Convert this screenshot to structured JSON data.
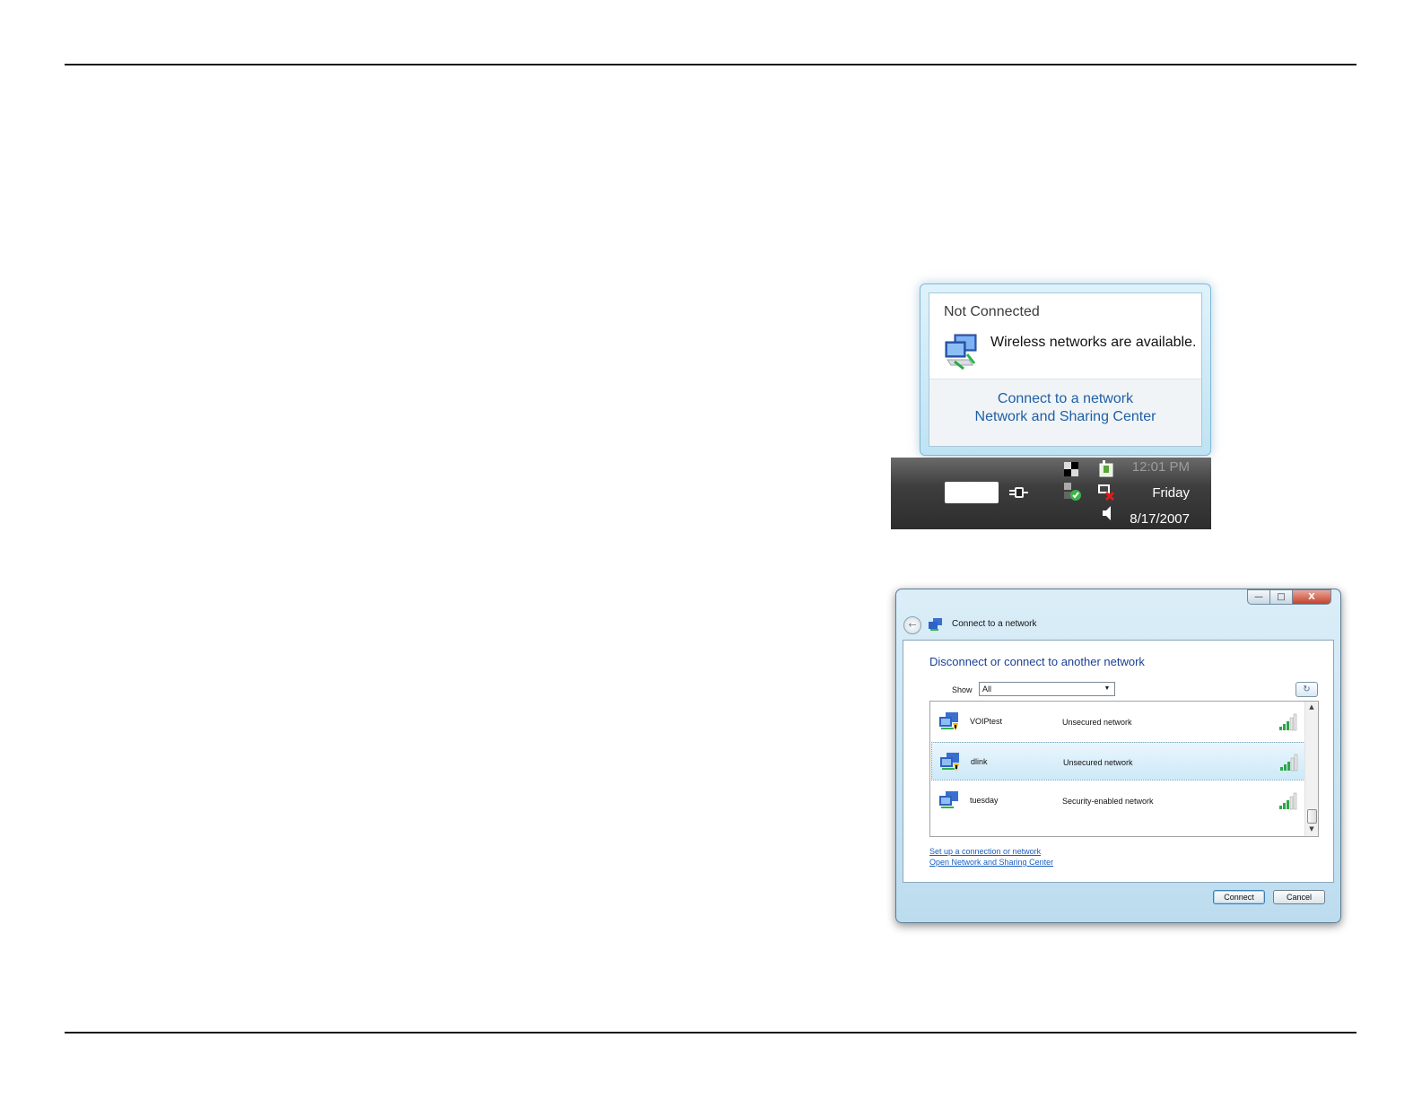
{
  "tray_popup": {
    "status_title": "Not Connected",
    "message": "Wireless networks are available.",
    "links": [
      "Connect to a network",
      "Network and Sharing Center"
    ],
    "icon": "network-computers-icon"
  },
  "taskbar": {
    "time": "12:01 PM",
    "day": "Friday",
    "date": "8/17/2007",
    "icons": [
      "power-plug-icon",
      "network-signal-icon",
      "security-shield-icon",
      "removable-device-icon",
      "network-disconnected-icon",
      "speaker-icon"
    ]
  },
  "connect_window": {
    "title": "Connect to a network",
    "controls": {
      "minimize": "—",
      "maximize": "□",
      "close": "X"
    },
    "heading": "Disconnect or connect to another network",
    "show_label": "Show",
    "show_value": "All",
    "networks": [
      {
        "name": "VOIPtest",
        "security": "Unsecured network",
        "signal": "excellent"
      },
      {
        "name": "dlink",
        "security": "Unsecured network",
        "signal": "excellent",
        "selected": true
      },
      {
        "name": "tuesday",
        "security": "Security-enabled network",
        "signal": "excellent"
      }
    ],
    "links": {
      "setup": "Set up a connection or network",
      "sharing": "Open Network and Sharing Center"
    },
    "buttons": {
      "connect": "Connect",
      "cancel": "Cancel"
    }
  },
  "colors": {
    "link_blue": "#1f5fa6",
    "heading_blue": "#1c3f94",
    "selection": "#cde9f8",
    "taskbar": "#2d2d2d"
  }
}
